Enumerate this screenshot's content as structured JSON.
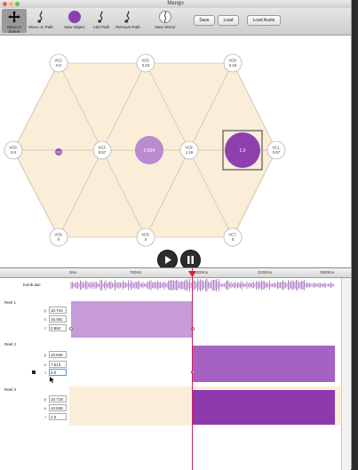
{
  "window": {
    "title": "Mango"
  },
  "toolbar": {
    "move_in_scene": "Move in Scene",
    "move_on_path": "Move on Path",
    "new_object": "New Object",
    "add_path": "Add Path",
    "remove_path": "Remove Path",
    "new_vector": "New Vector",
    "save": "Save",
    "load": "Load",
    "load_audio": "Load Audio"
  },
  "nodes": [
    {
      "label": "VC2:",
      "value": "0.0"
    },
    {
      "label": "VC5:",
      "value": "0.23"
    },
    {
      "label": "VC8:",
      "value": "0.16"
    },
    {
      "label": "VC0:",
      "value": "0.0"
    },
    {
      "label": "VC3:",
      "value": "0.57"
    },
    {
      "label": "VC6:",
      "value": "1.18"
    },
    {
      "label": "VC1:",
      "value": "0.67"
    },
    {
      "label": "VC9:",
      "value": "0"
    },
    {
      "label": "VC8:",
      "value": "0"
    },
    {
      "label": "VC7:",
      "value": "0"
    }
  ],
  "objects": [
    {
      "label": "0.8",
      "color": "#9b59b6"
    },
    {
      "label": "0.834",
      "color": "#b98bd0"
    },
    {
      "label": "1.0",
      "color": "#8e3fae"
    }
  ],
  "ruler": {
    "ticks": [
      "0ms",
      "700ms",
      "1400ms",
      "2100ms",
      "2800ms"
    ]
  },
  "audio": {
    "name": "bomb.aac"
  },
  "tracks": [
    {
      "name": "Reel 1",
      "y": "10.744",
      "x": "16.051",
      "r": "0.852"
    },
    {
      "name": "Reel 2",
      "y": "10.846",
      "x": "7.513",
      "r": "0.0"
    },
    {
      "name": "Reel 3",
      "y": "10.718",
      "x": "10.846",
      "r": "1.0"
    }
  ],
  "field_labels": {
    "y": "y",
    "x": "x",
    "r": "r"
  },
  "colors": {
    "hex_fill": "#fbeed9",
    "track_light": "#c69bd8",
    "track_mid": "#a562c3",
    "track_dark": "#8d3aad",
    "playhead": "#d02060"
  }
}
